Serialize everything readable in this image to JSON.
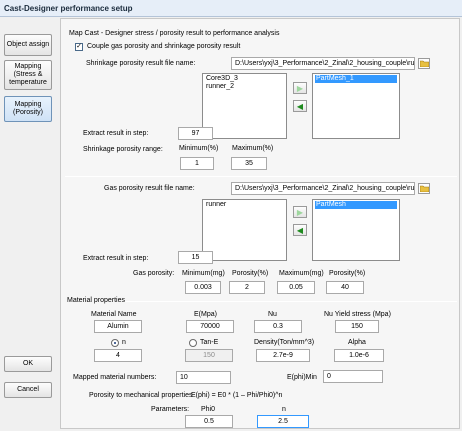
{
  "window": {
    "title": "Cast-Designer performance setup"
  },
  "nav": {
    "object_assign": "Object assign",
    "mapping_stress_1": "Mapping",
    "mapping_stress_2": "(Stress &",
    "mapping_stress_3": "temperature",
    "mapping_porosity_1": "Mapping",
    "mapping_porosity_2": "(Porosity)",
    "ok": "OK",
    "cancel": "Cancel"
  },
  "header": {
    "title": "Map Cast - Designer stress / porosity result to performance analysis",
    "couple_label": "Couple gas porosity and shrinkage porosity result",
    "couple_checked": true
  },
  "shrinkage": {
    "file_label": "Shrinkage porosity result file name:",
    "file_value": "D:\\Users\\yxj\\3_Performance\\2_Zinal\\2_housing_couple\\run\\R_TF_New\\R_1",
    "left_list": [
      "Core3D_3",
      "runner_2"
    ],
    "right_list": [
      "PartMesh_1"
    ],
    "step_label": "Extract result in step:",
    "step_value": "97",
    "range_label": "Shrinkage porosity range:",
    "min_label": "Minimum(%)",
    "max_label": "Maximum(%)",
    "min_value": "1",
    "max_value": "35"
  },
  "gas": {
    "file_label": "Gas porosity result file name:",
    "file_value": "D:\\Users\\yxj\\3_Performance\\2_Zinal\\2_housing_couple\\run\\gas_porosity\\g",
    "left_list": [
      "runner"
    ],
    "right_list": [
      "PartMesh"
    ],
    "step_label": "Extract result in step:",
    "step_value": "15",
    "porosity_label": "Gas porosity:",
    "col1_label": "Minimum(mg)",
    "col2_label": "Porosity(%)",
    "col3_label": "Maximum(mg)",
    "col4_label": "Porosity(%)",
    "col1_value": "0.003",
    "col2_value": "2",
    "col3_value": "0.05",
    "col4_value": "40"
  },
  "material": {
    "section_label": "Material properties",
    "name_label": "Material Name",
    "e_label": "E(Mpa)",
    "nu_label": "Nu",
    "yield_label": "Nu Yield stress (Mpa)",
    "name_value": "Alumin",
    "e_value": "70000",
    "nu_value": "0.3",
    "yield_value": "150",
    "n_label": "n",
    "tane_label": "Tan-E",
    "density_label": "Density(Ton/mm^3)",
    "alpha_label": "Alpha",
    "n_value": "4",
    "tane_value": "150",
    "density_value": "2.7e-9",
    "alpha_value": "1.0e-6",
    "mapped_label": "Mapped material numbers:",
    "mapped_value": "10",
    "ephi_min_label": "E(phi)Min",
    "ephi_min_value": "0",
    "formula_label": "Porosity to mechanical properties",
    "formula_text": "E(phi) = E0 * (1 – Phi/Phi0)^n",
    "params_label": "Parameters:",
    "phi0_label": "Phi0",
    "n2_label": "n",
    "phi0_value": "0.5",
    "n2_value": "2.5"
  }
}
